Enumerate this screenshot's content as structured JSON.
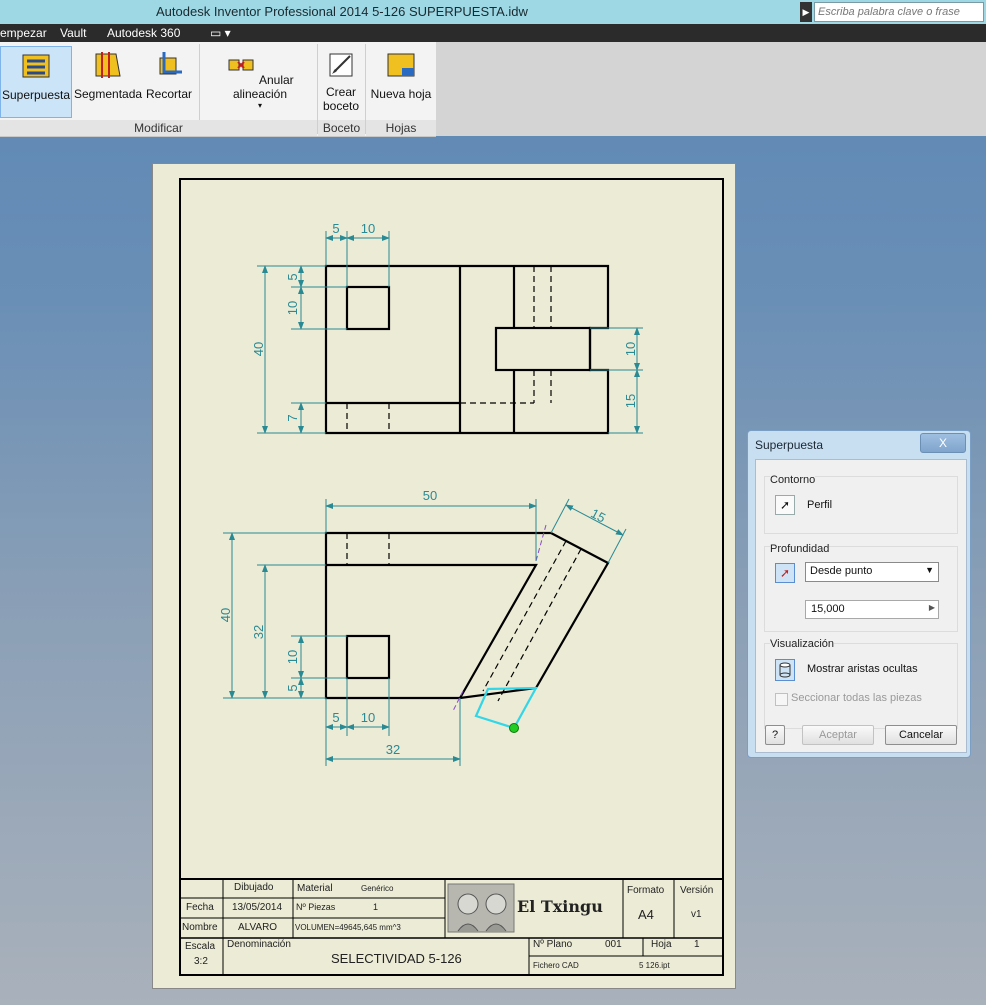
{
  "app": {
    "title": "Autodesk Inventor Professional 2014    5-126 SUPERPUESTA.idw",
    "search_placeholder": "Escriba palabra clave o frase"
  },
  "menubar": {
    "items": [
      "empezar",
      "Vault",
      "Autodesk 360",
      "▭ ▾"
    ]
  },
  "ribbon": {
    "buttons": {
      "superpuesta": "Superpuesta",
      "segmentada": "Segmentada",
      "recortar": "Recortar",
      "anular": "Anular alineación",
      "crear_line1": "Crear",
      "crear_line2": "boceto",
      "nueva_hoja": "Nueva hoja"
    },
    "groups": {
      "modificar": "Modificar",
      "boceto": "Boceto",
      "hojas": "Hojas"
    }
  },
  "drawing": {
    "dims": {
      "top_5": "5",
      "top_10": "10",
      "left_5": "5",
      "left_10": "10",
      "left_40": "40",
      "left_7": "7",
      "right_10": "10",
      "right_15": "15",
      "d50": "50",
      "d15": "15",
      "bl_40": "40",
      "bl_32": "32",
      "bl_10": "10",
      "bl_5": "5",
      "bot_5": "5",
      "bot_10": "10",
      "bot_32": "32"
    },
    "colors": {
      "line": "#000000",
      "dim": "#2a8a94",
      "highlight": "#33d6e6",
      "point": "#22cc22"
    }
  },
  "titleblock": {
    "dibujado": "Dibujado",
    "material_label": "Material",
    "material_value": "Genérico",
    "fecha_label": "Fecha",
    "fecha_value": "13/05/2014",
    "piezas_label": "Nº Piezas",
    "piezas_value": "1",
    "nombre_label": "Nombre",
    "nombre_value": "ALVARO",
    "volumen": "VOLUMEN=49645,645 mm^3",
    "logo_text": "El Txingu",
    "formato_label": "Formato",
    "formato_value": "A4",
    "version_label": "Versión",
    "version_value": "v1",
    "escala_label": "Escala",
    "escala_value": "3:2",
    "denominacion_label": "Denominación",
    "denominacion_value": "SELECTIVIDAD 5-126",
    "plano_label": "Nº Plano",
    "plano_value": "001",
    "hoja_label": "Hoja",
    "hoja_value": "1",
    "fichero_label": "Fichero CAD",
    "fichero_value": "5 126.ipt"
  },
  "dialog": {
    "title": "Superpuesta",
    "close": "X",
    "contorno_label": "Contorno",
    "perfil_label": "Perfil",
    "profundidad_label": "Profundidad",
    "depth_selected": "Desde punto",
    "depth_value": "15,000",
    "visualizacion_label": "Visualización",
    "hidden_edges_label": "Mostrar aristas ocultas",
    "section_all_label": "Seccionar todas las piezas",
    "help": "?",
    "aceptar": "Aceptar",
    "cancelar": "Cancelar"
  }
}
